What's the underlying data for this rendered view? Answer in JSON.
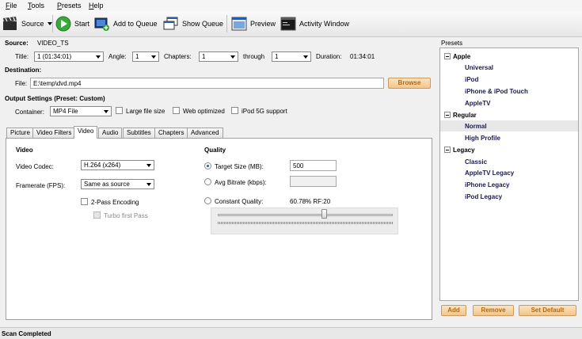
{
  "menu": [
    {
      "label": "File",
      "u": "F",
      "rest": "ile"
    },
    {
      "label": "Tools",
      "u": "T",
      "rest": "ools"
    },
    {
      "label": "Presets",
      "u": "P",
      "rest": "resets"
    },
    {
      "label": "Help",
      "u": "H",
      "rest": "elp"
    }
  ],
  "toolbar": {
    "source": "Source",
    "start": "Start",
    "add_queue": "Add to Queue",
    "show_queue": "Show Queue",
    "preview": "Preview",
    "activity": "Activity Window"
  },
  "source": {
    "label": "Source:",
    "value": "VIDEO_TS",
    "title_label": "Title:",
    "title_value": "1 (01:34:01)",
    "angle_label": "Angle:",
    "angle_value": "1",
    "chapters_label": "Chapters:",
    "chapters_from": "1",
    "through_label": "through",
    "chapters_to": "1",
    "duration_label": "Duration:",
    "duration_value": "01:34:01"
  },
  "destination": {
    "label": "Destination:",
    "file_label": "File:",
    "file_value": "E:\\temp\\dvd.mp4",
    "browse": "Browse"
  },
  "output": {
    "label": "Output Settings (Preset: Custom)",
    "container_label": "Container:",
    "container_value": "MP4 File",
    "large_file": "Large file size",
    "web_optimized": "Web optimized",
    "ipod5g": "iPod 5G support"
  },
  "tabs": [
    "Picture",
    "Video Filters",
    "Video",
    "Audio",
    "Subtitles",
    "Chapters",
    "Advanced"
  ],
  "video": {
    "heading": "Video",
    "codec_label": "Video Codec:",
    "codec_value": "H.264 (x264)",
    "framerate_label": "Framerate (FPS):",
    "framerate_value": "Same as source",
    "two_pass": "2-Pass Encoding",
    "turbo": "Turbo first Pass"
  },
  "quality": {
    "heading": "Quality",
    "target_size_label": "Target Size (MB):",
    "target_size_value": "500",
    "avg_bitrate_label": "Avg Bitrate (kbps):",
    "avg_bitrate_value": "",
    "constant_label": "Constant Quality:",
    "constant_value": "60.78% RF:20",
    "slider_fraction": 0.6078
  },
  "presets": {
    "title": "Presets",
    "groups": [
      {
        "name": "Apple",
        "items": [
          "Universal",
          "iPod",
          "iPhone & iPod Touch",
          "AppleTV"
        ]
      },
      {
        "name": "Regular",
        "items": [
          "Normal",
          "High Profile"
        ]
      },
      {
        "name": "Legacy",
        "items": [
          "Classic",
          "AppleTV Legacy",
          "iPhone Legacy",
          "iPod Legacy"
        ]
      }
    ],
    "selected": "Normal",
    "add": "Add",
    "remove": "Remove",
    "set_default": "Set Default"
  },
  "status": "Scan Completed",
  "colors": {
    "accent_orange": "#b06a10",
    "selection": "#e8e8e8"
  }
}
